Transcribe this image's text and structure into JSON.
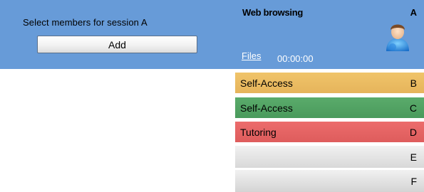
{
  "left_panel": {
    "select_label": "Select members for session  A",
    "add_label": "Add"
  },
  "session_a": {
    "title": "Web browsing",
    "letter": "A",
    "files_label": "Files",
    "timer": "00:00:00",
    "icon": "user-icon"
  },
  "sessions": [
    {
      "label": "Self-Access",
      "letter": "B",
      "color": "#e6b45b"
    },
    {
      "label": "Self-Access",
      "letter": "C",
      "color": "#4a9a5c"
    },
    {
      "label": "Tutoring",
      "letter": "D",
      "color": "#de5c5c"
    },
    {
      "label": "",
      "letter": "E",
      "color": "#e0e0e0"
    },
    {
      "label": "",
      "letter": "F",
      "color": "#e0e0e0"
    }
  ],
  "colors": {
    "panel_blue": "#679bd8"
  }
}
